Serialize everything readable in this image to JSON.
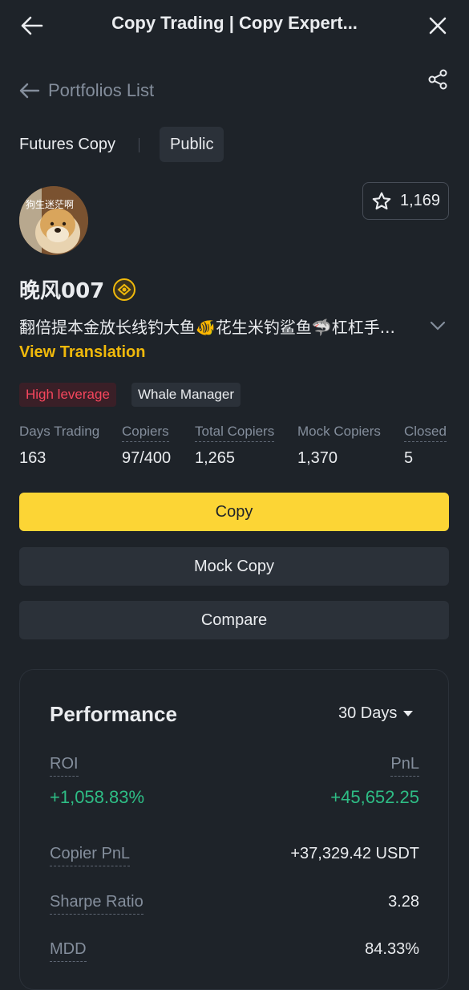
{
  "header": {
    "title": "Copy Trading | Copy Expert..."
  },
  "nav": {
    "back_label": "Portfolios List"
  },
  "segments": {
    "futures": "Futures Copy",
    "public": "Public"
  },
  "profile": {
    "avatar_caption": "狗生迷茫啊",
    "favorites_count": "1,169",
    "name": "晚风007",
    "bio": "翻倍提本金放长线钓大鱼🐠花生米钓鲨鱼🦈杠杠手...",
    "view_translation": "View Translation",
    "tags": [
      "High leverage",
      "Whale Manager"
    ]
  },
  "stats": [
    {
      "label": "Days Trading",
      "value": "163"
    },
    {
      "label": "Copiers",
      "value": "97/400"
    },
    {
      "label": "Total Copiers",
      "value": "1,265"
    },
    {
      "label": "Mock Copiers",
      "value": "1,370"
    },
    {
      "label": "Closed",
      "value": "5"
    }
  ],
  "actions": {
    "copy": "Copy",
    "mock_copy": "Mock Copy",
    "compare": "Compare"
  },
  "performance": {
    "title": "Performance",
    "period": "30 Days",
    "roi_label": "ROI",
    "roi_value": "+1,058.83%",
    "pnl_label": "PnL",
    "pnl_value": "+45,652.25",
    "copier_pnl_label": "Copier PnL",
    "copier_pnl_value": "+37,329.42 USDT",
    "sharpe_label": "Sharpe Ratio",
    "sharpe_value": "3.28",
    "mdd_label": "MDD",
    "mdd_value": "84.33%"
  },
  "colors": {
    "background": "#1e2329",
    "accent_yellow": "#fcd535",
    "link_yellow": "#f0b90b",
    "positive_green": "#2ebd85",
    "warning_red": "#f6465d"
  }
}
